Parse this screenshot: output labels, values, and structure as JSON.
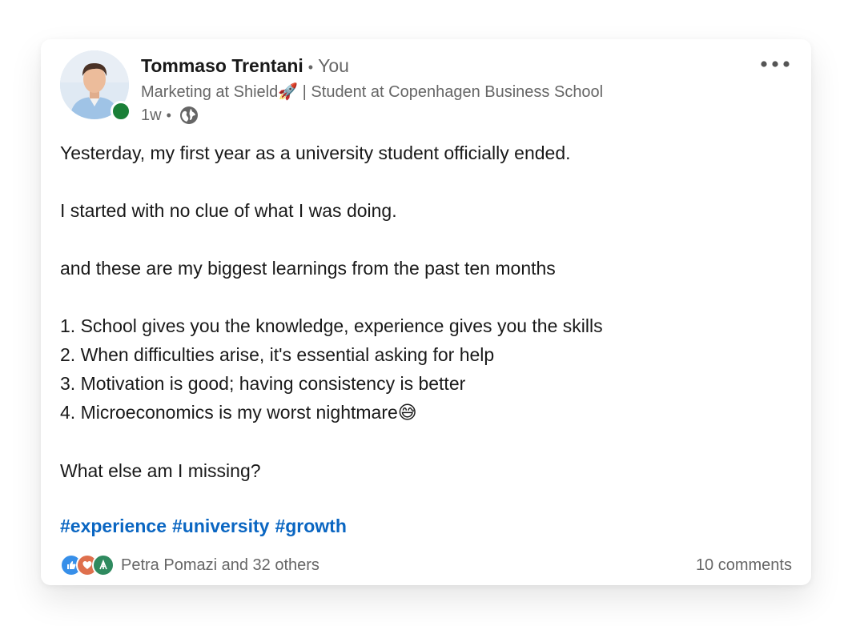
{
  "author": {
    "name": "Tommaso Trentani",
    "relation": "You",
    "headline_prefix": "Marketing at Shield",
    "headline_emoji": "🚀",
    "headline_suffix": " | Student at Copenhagen Business School",
    "time_ago": "1w",
    "visibility_icon": "globe-icon",
    "online_status_color": "#1a7f37"
  },
  "post": {
    "lines": [
      "Yesterday, my first year as a university student officially ended.",
      "I started with no clue of what I was doing.",
      "and these are my biggest learnings from the past ten months",
      "1. School gives you the knowledge, experience gives you the skills",
      "2. When difficulties arise, it's essential asking for help",
      "3. Motivation is good; having consistency is better",
      "4. Microeconomics is my worst nightmare",
      "What else am I missing?"
    ],
    "line4_emoji": "😅",
    "hashtags": [
      "#experience",
      "#university",
      "#growth"
    ]
  },
  "social": {
    "reaction_icons": [
      "like-icon",
      "love-icon",
      "insightful-icon"
    ],
    "reactions_text": "Petra Pomazi and 32 others",
    "comments_text": "10 comments"
  },
  "menu": {
    "more_icon": "more-horizontal-icon"
  },
  "colors": {
    "link": "#0a66c2",
    "secondary_text": "#666666",
    "like": "#378fe9",
    "love": "#df704d",
    "insightful": "#2f8a5f"
  }
}
